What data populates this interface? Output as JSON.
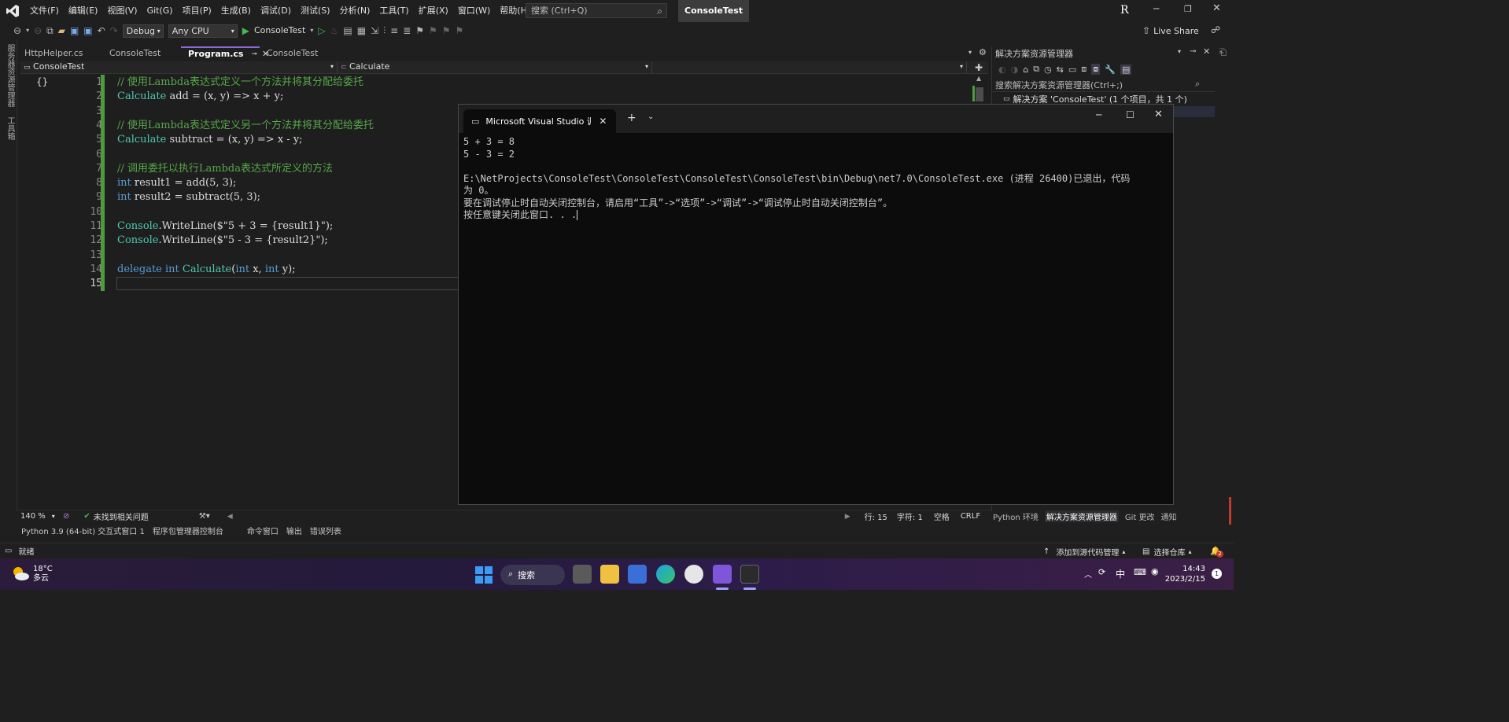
{
  "menubar": {
    "items": [
      "文件(F)",
      "编辑(E)",
      "视图(V)",
      "Git(G)",
      "项目(P)",
      "生成(B)",
      "调试(D)",
      "测试(S)",
      "分析(N)",
      "工具(T)",
      "扩展(X)",
      "窗口(W)",
      "帮助(H)"
    ],
    "search_placeholder": "搜索 (Ctrl+Q)",
    "app_title": "ConsoleTest",
    "account_initial": "R"
  },
  "toolbar": {
    "config": "Debug",
    "platform": "Any CPU",
    "run_target": "ConsoleTest",
    "live_share": "Live Share"
  },
  "left_strip": {
    "tabs": [
      "服务器资源管理器",
      "工具箱"
    ]
  },
  "doc_tabs": [
    {
      "label": "HttpHelper.cs",
      "active": false
    },
    {
      "label": "ConsoleTest",
      "active": false
    },
    {
      "label": "Program.cs",
      "active": true
    },
    {
      "label": "ConsoleTest",
      "active": false
    }
  ],
  "navbar": {
    "project": "ConsoleTest",
    "member": "Calculate"
  },
  "editor": {
    "line_numbers": [
      "1",
      "2",
      "3",
      "4",
      "5",
      "6",
      "7",
      "8",
      "9",
      "10",
      "11",
      "12",
      "13",
      "14",
      "15"
    ],
    "lines": [
      [
        {
          "t": "// 使用Lambda表达式定义一个方法并将其分配给委托",
          "c": "cmt"
        }
      ],
      [
        {
          "t": "Calculate",
          "c": "ty"
        },
        {
          "t": " add = (x, y) => x + y;",
          "c": ""
        }
      ],
      [],
      [
        {
          "t": "// 使用Lambda表达式定义另一个方法并将其分配给委托",
          "c": "cmt"
        }
      ],
      [
        {
          "t": "Calculate",
          "c": "ty"
        },
        {
          "t": " subtract = (x, y) => x - y;",
          "c": ""
        }
      ],
      [],
      [
        {
          "t": "// 调用委托以执行Lambda表达式所定义的方法",
          "c": "cmt"
        }
      ],
      [
        {
          "t": "int",
          "c": "kw"
        },
        {
          "t": " result1 = add(5, 3);",
          "c": ""
        }
      ],
      [
        {
          "t": "int",
          "c": "kw"
        },
        {
          "t": " result2 = subtract(5, 3);",
          "c": ""
        }
      ],
      [],
      [
        {
          "t": "Console",
          "c": "ty"
        },
        {
          "t": ".WriteLine($\"5 + 3 = {result1}\");",
          "c": ""
        }
      ],
      [
        {
          "t": "Console",
          "c": "ty"
        },
        {
          "t": ".WriteLine($\"5 - 3 = {result2}\");",
          "c": ""
        }
      ],
      [],
      [
        {
          "t": "delegate",
          "c": "kw"
        },
        {
          "t": " ",
          "c": ""
        },
        {
          "t": "int",
          "c": "kw"
        },
        {
          "t": " ",
          "c": ""
        },
        {
          "t": "Calculate",
          "c": "ty"
        },
        {
          "t": "(",
          "c": ""
        },
        {
          "t": "int",
          "c": "kw"
        },
        {
          "t": " x, ",
          "c": ""
        },
        {
          "t": "int",
          "c": "kw"
        },
        {
          "t": " y);",
          "c": ""
        }
      ],
      []
    ],
    "current_line": "15"
  },
  "solution_explorer": {
    "title": "解决方案资源管理器",
    "search_placeholder": "搜索解决方案资源管理器(Ctrl+;)",
    "root": "解决方案 'ConsoleTest' (1 个项目，共 1 个)"
  },
  "console": {
    "tab_title": "Microsoft Visual Studio 调试控",
    "output": "5 + 3 = 8\n5 - 3 = 2\n\nE:\\NetProjects\\ConsoleTest\\ConsoleTest\\ConsoleTest\\ConsoleTest\\bin\\Debug\\net7.0\\ConsoleTest.exe (进程 26400)已退出，代码\n为 0。\n要在调试停止时自动关闭控制台，请启用“工具”->“选项”->“调试”->“调试停止时自动关闭控制台”。\n按任意键关闭此窗口. . ."
  },
  "editor_status": {
    "zoom": "140 %",
    "issues": "未找到相关问题",
    "line": "行: 15",
    "char": "字符: 1",
    "spaces": "空格",
    "eol": "CRLF"
  },
  "right_tabs": [
    "Python 环境",
    "解决方案资源管理器",
    "Git 更改",
    "通知"
  ],
  "bottom_tabs": [
    "Python 3.9 (64-bit) 交互式窗口 1",
    "程序包管理器控制台",
    "命令窗口",
    "输出",
    "错误列表"
  ],
  "status": {
    "ready": "就绪",
    "add_source": "添加到源代码管理",
    "select_repo": "选择仓库",
    "notif_count": "2"
  },
  "taskbar": {
    "temp": "18°C",
    "weather": "多云",
    "search": "搜索",
    "ime": "中",
    "time": "14:43",
    "date": "2023/2/15",
    "badge": "1"
  },
  "colors": {
    "comment": "#57a64a",
    "keyword": "#569cd6",
    "type": "#4ec9b0",
    "accent": "#8c6ad6",
    "vs_purple": "#7f56d9"
  }
}
